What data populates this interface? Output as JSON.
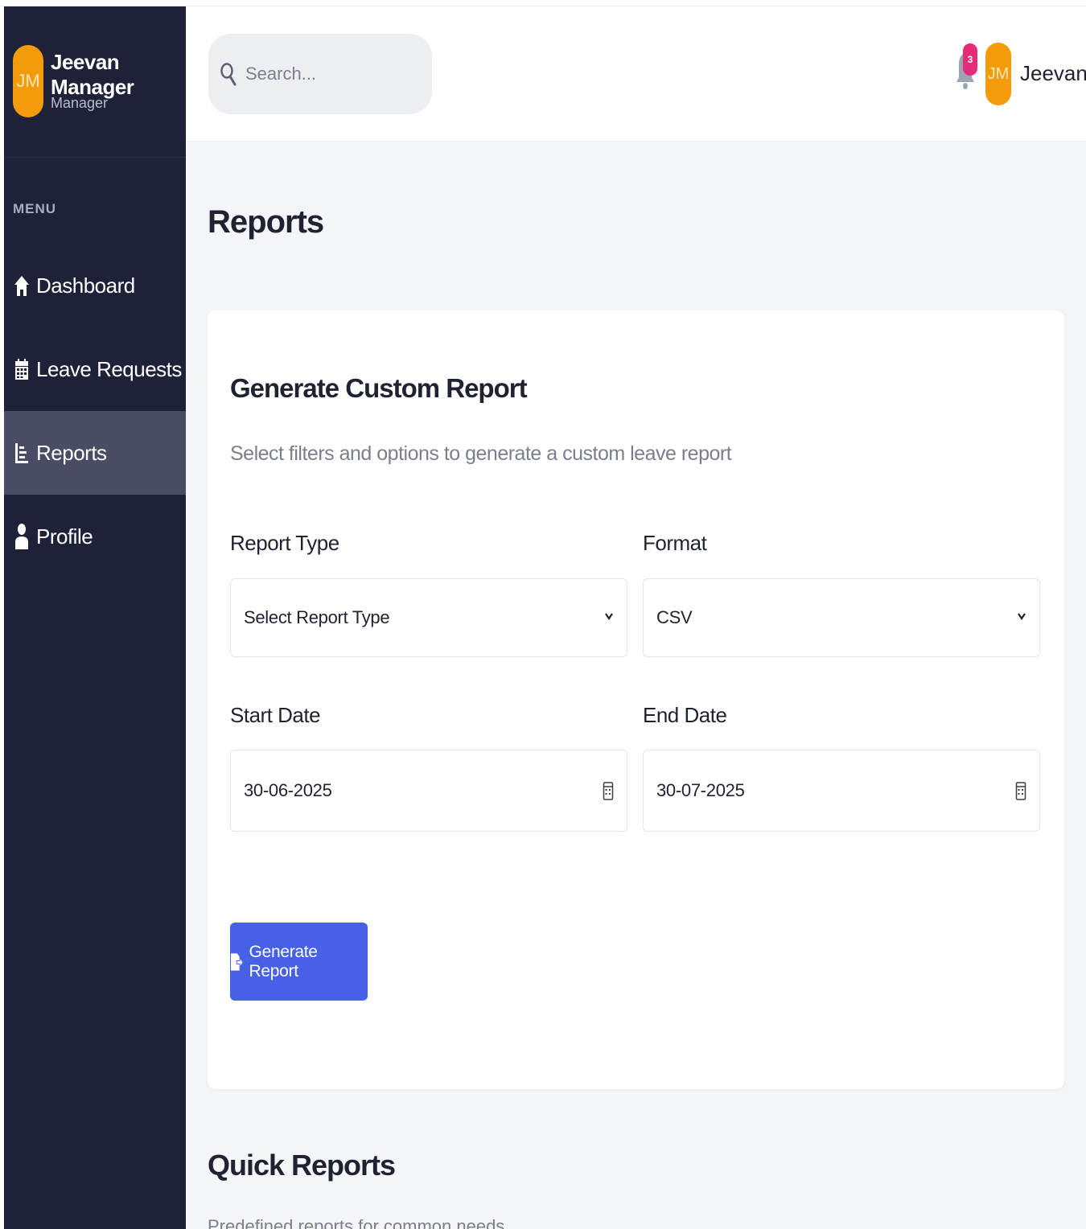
{
  "user": {
    "initials": "JM",
    "full_name": "Jeevan Manager",
    "role": "Manager",
    "short_name": "Jeevan"
  },
  "sidebar": {
    "menu_label": "MENU",
    "items": [
      {
        "label": "Dashboard",
        "icon": "home-icon",
        "active": false
      },
      {
        "label": "Leave Requests",
        "icon": "calendar-icon",
        "active": false
      },
      {
        "label": "Reports",
        "icon": "chart-icon",
        "active": true
      },
      {
        "label": "Profile",
        "icon": "user-icon",
        "active": false
      }
    ]
  },
  "header": {
    "search_placeholder": "Search...",
    "notification_count": "3"
  },
  "page": {
    "title": "Reports"
  },
  "custom_report": {
    "title": "Generate Custom Report",
    "subtitle": "Select filters and options to generate a custom leave report",
    "report_type_label": "Report Type",
    "report_type_value": "Select Report Type",
    "format_label": "Format",
    "format_value": "CSV",
    "start_date_label": "Start Date",
    "start_date_value": "30-06-2025",
    "end_date_label": "End Date",
    "end_date_value": "30-07-2025",
    "generate_button": "Generate Report"
  },
  "quick_reports": {
    "title": "Quick Reports",
    "subtitle": "Predefined reports for common needs"
  },
  "colors": {
    "sidebar_bg": "#1f2139",
    "sidebar_active": "#4a4c63",
    "avatar": "#f49b0b",
    "primary_button": "#4661e6",
    "badge": "#e52b7a",
    "page_bg": "#f4f5f8"
  }
}
